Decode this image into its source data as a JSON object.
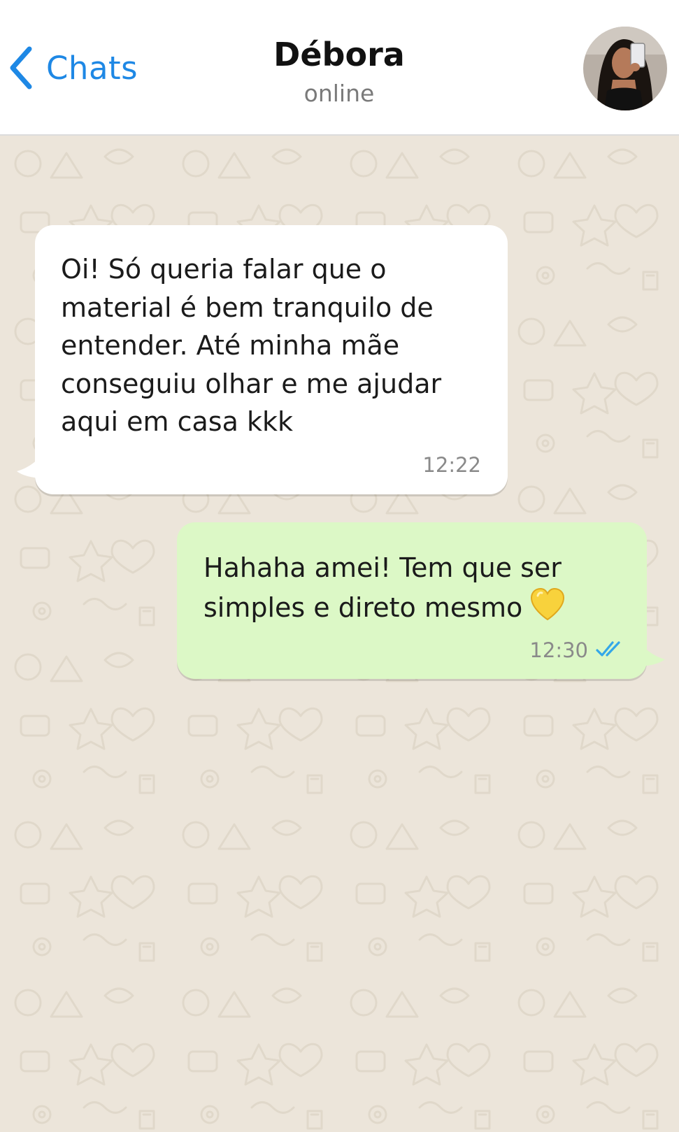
{
  "header": {
    "back_label": "Chats",
    "contact_name": "Débora",
    "contact_status": "online"
  },
  "messages": [
    {
      "direction": "incoming",
      "text": "Oi! Só queria falar que o\nmaterial é bem tranquilo de\nentender. Até minha mãe\nconseguiu olhar e me ajudar\naqui em casa kkk",
      "time": "12:22"
    },
    {
      "direction": "outgoing",
      "text": "Hahaha amei! Tem que ser\nsimples e direto mesmo",
      "emoji": "yellow-heart-icon",
      "time": "12:30",
      "status": "read"
    }
  ],
  "icons": {
    "back": "chevron-left-icon",
    "read_receipt": "double-check-icon"
  },
  "colors": {
    "accent": "#1E88E5",
    "outgoing_bubble": "#DCF8C6",
    "incoming_bubble": "#FFFFFF",
    "chat_background": "#ECE5DA",
    "read_receipt": "#34A7E8"
  }
}
